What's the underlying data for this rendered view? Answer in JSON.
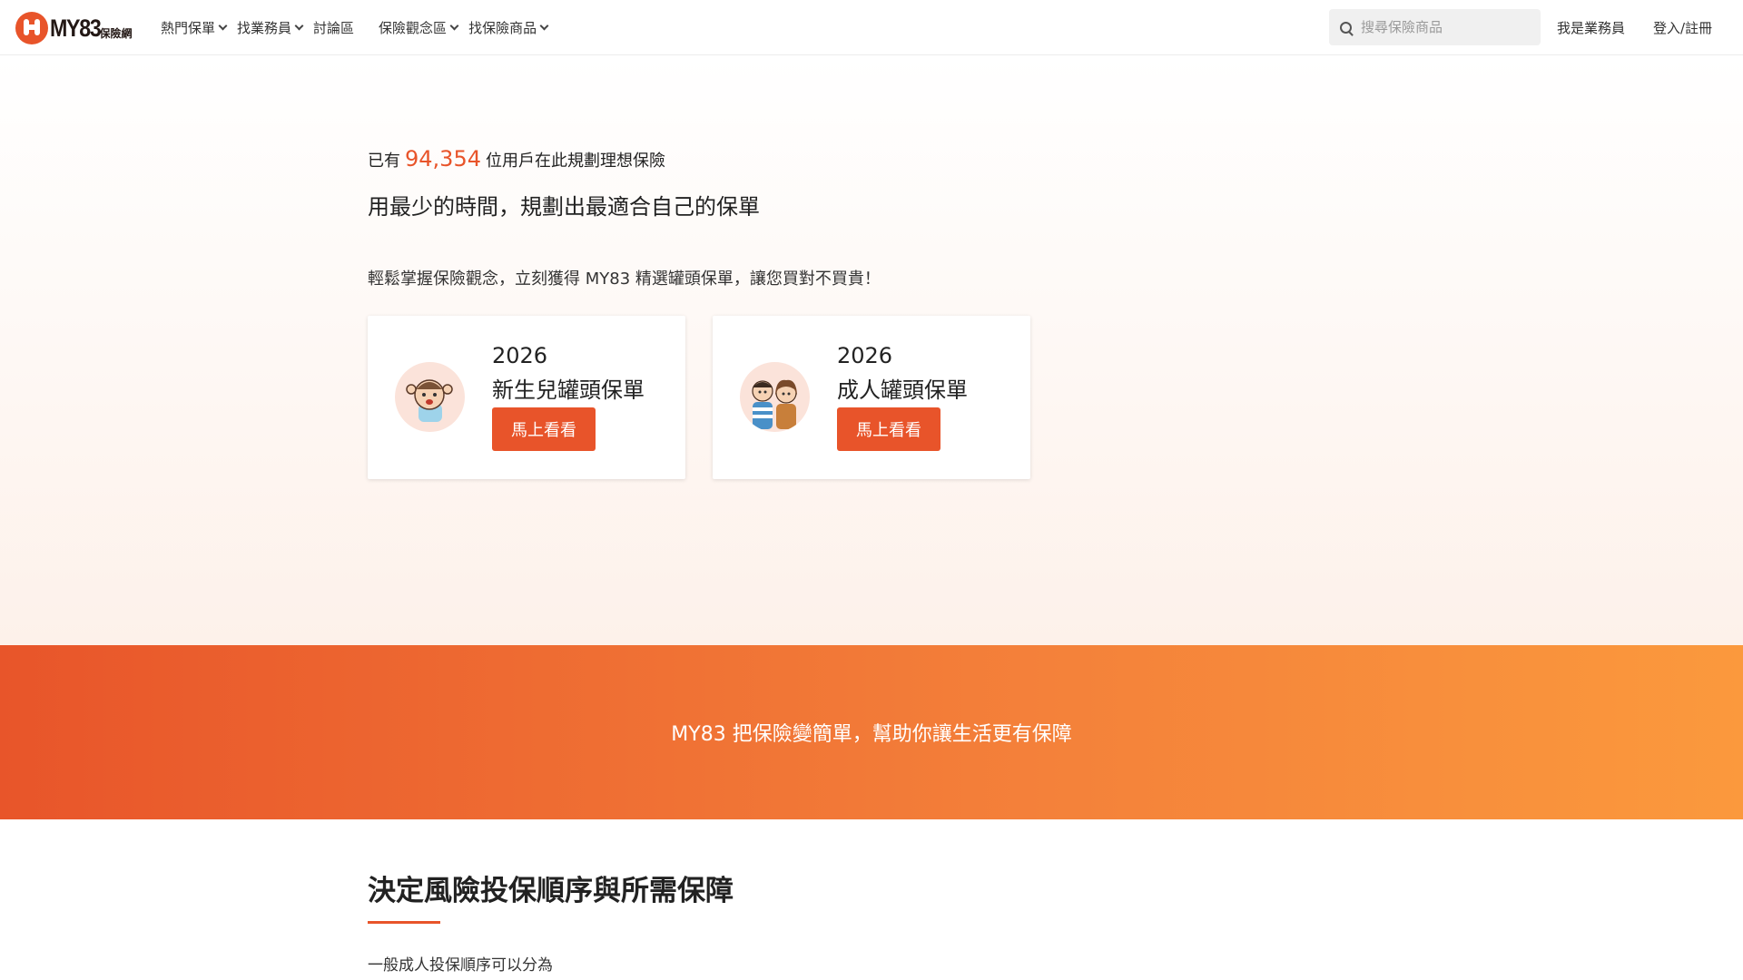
{
  "header": {
    "logo_text": "MY83",
    "logo_sub": "保險網",
    "nav": [
      {
        "label": "熱門保單",
        "dropdown": true
      },
      {
        "label": "找業務員",
        "dropdown": true
      },
      {
        "label": "討論區",
        "dropdown": false
      },
      {
        "label": "保險觀念區",
        "dropdown": true
      },
      {
        "label": "找保險商品",
        "dropdown": true
      }
    ],
    "search_placeholder": "搜尋保險商品",
    "agent_link": "我是業務員",
    "login_link": "登入/註冊"
  },
  "hero": {
    "users_prefix": "已有",
    "users_count": "94,354",
    "users_suffix": "位用戶在此規劃理想保險",
    "headline": "用最少的時間，規劃出最適合自己的保單",
    "subline": "輕鬆掌握保險觀念，立刻獲得 MY83 精選罐頭保單，讓您買對不買貴！",
    "cards": [
      {
        "year": "2026",
        "title": "新生兒罐頭保單",
        "button": "馬上看看",
        "avatar": "baby-icon"
      },
      {
        "year": "2026",
        "title": "成人罐頭保單",
        "button": "馬上看看",
        "avatar": "couple-icon"
      }
    ]
  },
  "banner": {
    "text": "MY83 把保險變簡單，幫助你讓生活更有保障"
  },
  "section": {
    "title": "決定風險投保順序與所需保障",
    "body": "一般成人投保順序可以分為"
  },
  "colors": {
    "accent": "#e8542a",
    "banner_end": "#fb993d"
  }
}
